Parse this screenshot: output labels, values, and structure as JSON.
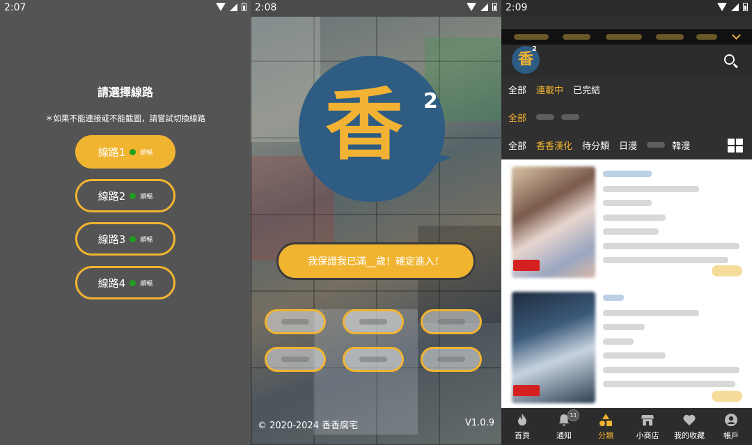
{
  "panel1": {
    "status_time": "2:07",
    "title": "請選擇線路",
    "hint": "＊如果不能連接或不能截圖，請嘗試切換線路",
    "routes": [
      {
        "label": "線路1",
        "status": "順暢"
      },
      {
        "label": "線路2",
        "status": "順暢"
      },
      {
        "label": "線路3",
        "status": "順暢"
      },
      {
        "label": "線路4",
        "status": "順暢"
      }
    ]
  },
  "panel2": {
    "status_time": "2:08",
    "logo_char": "香",
    "logo_sup": "2",
    "confirm_button": "我保證我已滿__歲！確定進入！",
    "copyright": "© 2020-2024 香香腐宅",
    "version": "V1.0.9"
  },
  "panel3": {
    "status_time": "2:09",
    "logo_char": "香",
    "logo_sup": "2",
    "filter_status": [
      "全部",
      "連載中",
      "已完結"
    ],
    "filter_sort_first": "全部",
    "filter_category": [
      "全部",
      "香香漢化",
      "待分類",
      "日漫",
      "韓漫"
    ],
    "nav": [
      {
        "label": "首頁",
        "icon": "flame-icon"
      },
      {
        "label": "通知",
        "icon": "bell-icon",
        "badge": "11"
      },
      {
        "label": "分類",
        "icon": "category-icon"
      },
      {
        "label": "小商店",
        "icon": "store-icon"
      },
      {
        "label": "我的收藏",
        "icon": "heart-icon"
      },
      {
        "label": "帳戶",
        "icon": "account-icon"
      }
    ]
  },
  "colors": {
    "accent": "#f0b431",
    "logo_blue": "#2e5c82",
    "status_dot": "#1f9f1f",
    "nav_bg": "#2c2c2c"
  }
}
